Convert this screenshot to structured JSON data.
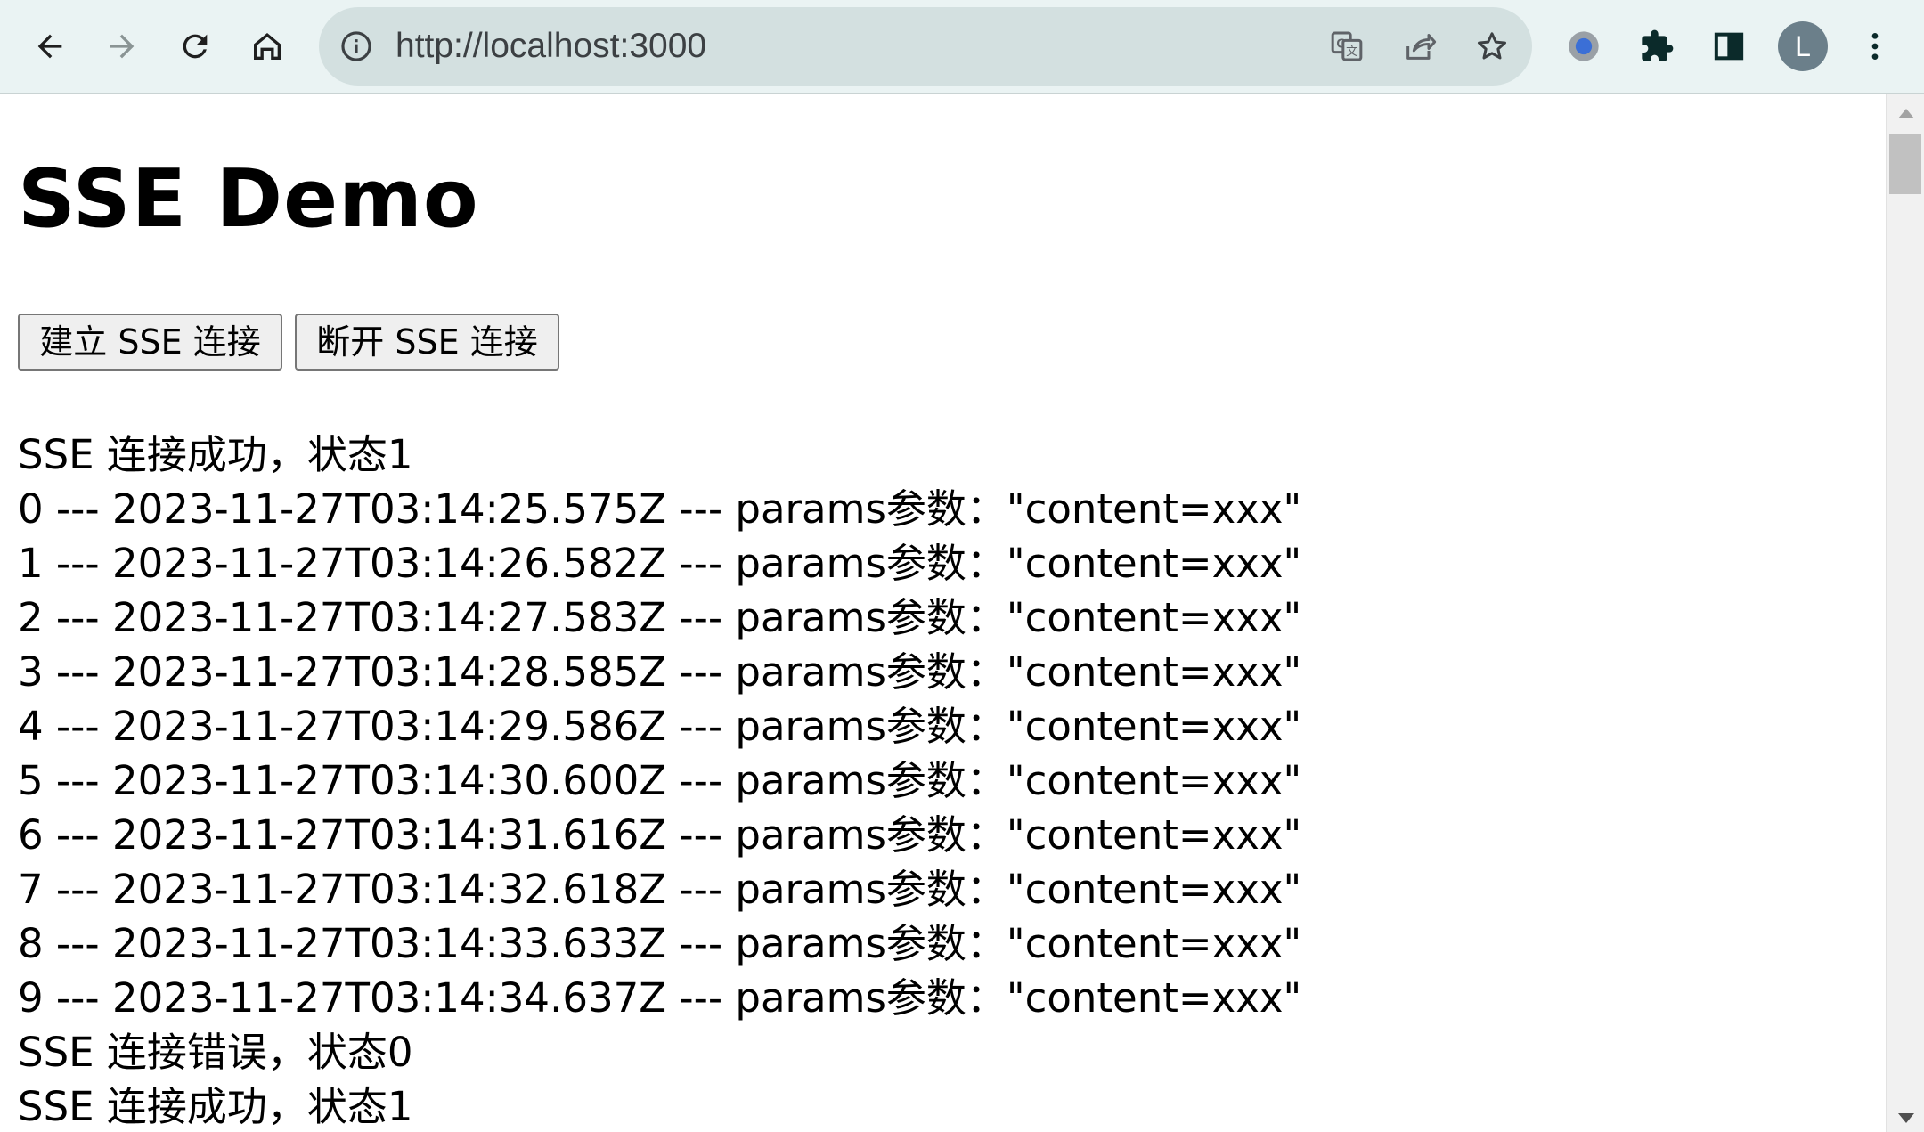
{
  "browser": {
    "url": "http://localhost:3000",
    "profile_initial": "L",
    "icons": {
      "back": "arrow-left-icon",
      "forward": "arrow-right-icon",
      "reload": "reload-icon",
      "home": "home-icon",
      "site_info": "info-icon",
      "translate": "translate-icon",
      "share": "share-icon",
      "bookmark": "star-icon",
      "extension_record": "record-icon",
      "extensions": "puzzle-icon",
      "side_panel": "side-panel-icon",
      "menu": "kebab-menu-icon"
    }
  },
  "page": {
    "title": "SSE Demo",
    "buttons": {
      "connect": "建立 SSE 连接",
      "disconnect": "断开 SSE 连接"
    },
    "log": [
      "SSE 连接成功，状态1",
      "0 --- 2023-11-27T03:14:25.575Z --- params参数：\"content=xxx\"",
      "1 --- 2023-11-27T03:14:26.582Z --- params参数：\"content=xxx\"",
      "2 --- 2023-11-27T03:14:27.583Z --- params参数：\"content=xxx\"",
      "3 --- 2023-11-27T03:14:28.585Z --- params参数：\"content=xxx\"",
      "4 --- 2023-11-27T03:14:29.586Z --- params参数：\"content=xxx\"",
      "5 --- 2023-11-27T03:14:30.600Z --- params参数：\"content=xxx\"",
      "6 --- 2023-11-27T03:14:31.616Z --- params参数：\"content=xxx\"",
      "7 --- 2023-11-27T03:14:32.618Z --- params参数：\"content=xxx\"",
      "8 --- 2023-11-27T03:14:33.633Z --- params参数：\"content=xxx\"",
      "9 --- 2023-11-27T03:14:34.637Z --- params参数：\"content=xxx\"",
      "SSE 连接错误，状态0",
      "SSE 连接成功，状态1"
    ]
  },
  "colors": {
    "toolbar_bg": "#eaf3f3",
    "omnibox_bg": "#d3e0e0",
    "icon": "#1f1f1f",
    "avatar_bg": "#6b7f8a",
    "record_blue": "#3b6fd6"
  }
}
